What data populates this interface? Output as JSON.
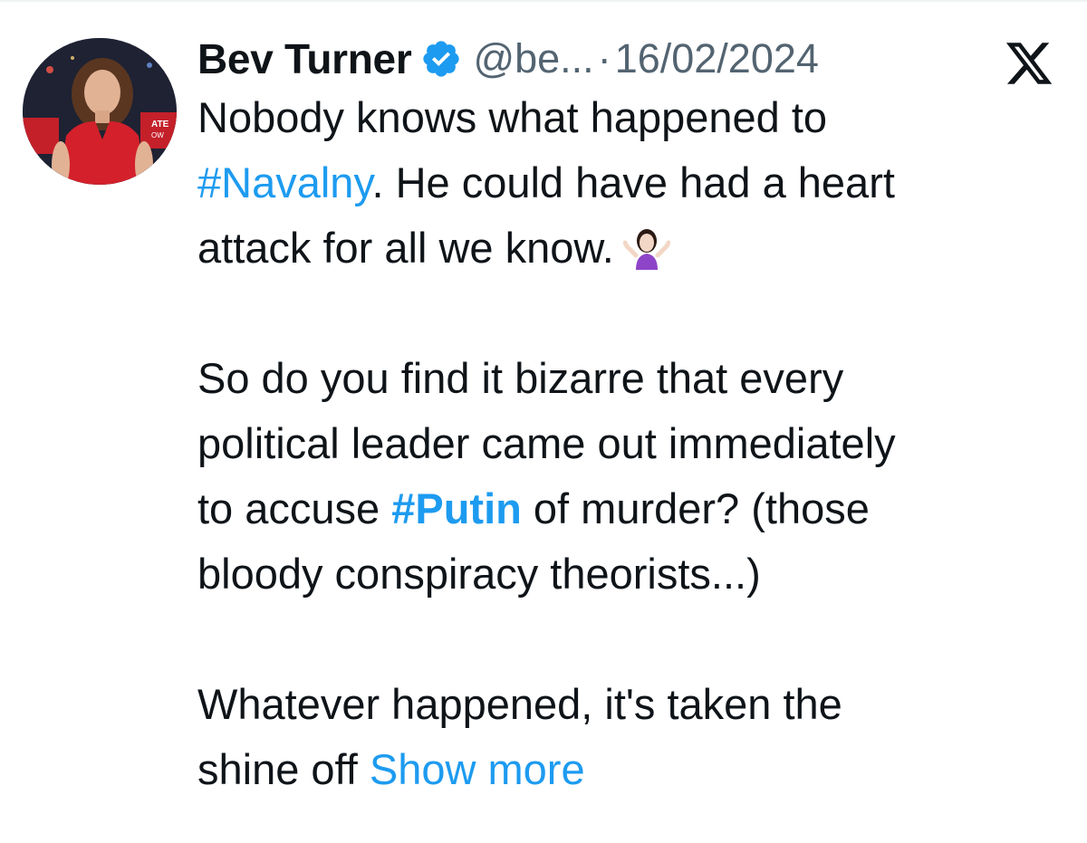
{
  "tweet": {
    "author_name": "Bev Turner",
    "handle": "@be...",
    "separator": "·",
    "timestamp": "16/02/2024",
    "icons": {
      "verified": "verified-badge-icon",
      "platform": "x-logo-icon",
      "emoji": "person-shrugging-emoji"
    },
    "colors": {
      "link": "#1d9bf0",
      "text": "#0f1419",
      "secondary": "#536471"
    },
    "text": {
      "p1_line1": "Nobody knows what happened to",
      "p1_hashtag": "#Navalny",
      "p1_line2_rest": ". He could have had a heart",
      "p1_line3": "attack for all we know.",
      "p2_line1": "So do you find it bizarre that every",
      "p2_line2": "political leader came out immediately",
      "p2_line3_start": "to accuse ",
      "p2_hashtag": "#Putin",
      "p2_line3_rest": " of murder? (those",
      "p2_line4": "bloody conspiracy theorists...)",
      "p3_line1": "Whatever happened, it's taken the",
      "p3_line2": "shine off",
      "show_more": "Show more"
    }
  }
}
